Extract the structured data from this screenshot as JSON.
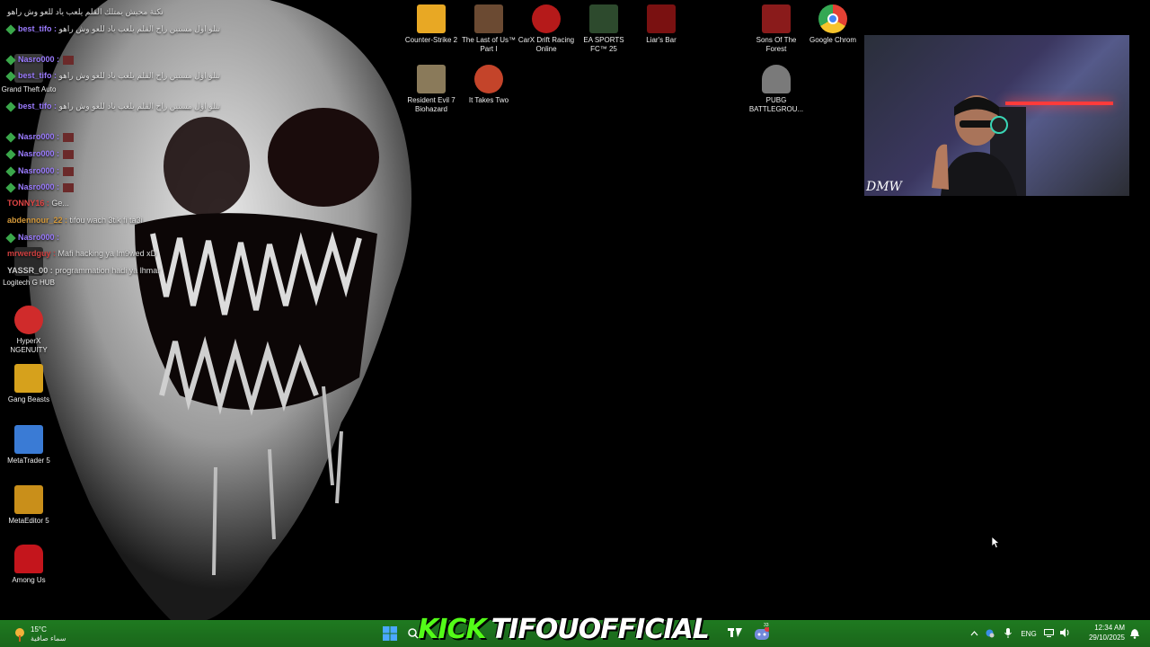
{
  "desktop": {
    "left_icons": [
      {
        "label": "Grand Theft Auto",
        "icon": "gta-icon",
        "color": "#3a3a3a"
      },
      {
        "label": "Logitech G HUB",
        "icon": "logitech-icon",
        "color": "#2a2a2a"
      },
      {
        "label": "HyperX NGENUITY",
        "icon": "hyperx-icon",
        "color": "#d02b2b"
      },
      {
        "label": "Gang Beasts",
        "icon": "gang-beasts-icon",
        "color": "#d6a11c"
      },
      {
        "label": "MetaTrader 5",
        "icon": "metatrader-icon",
        "color": "#3a7bd5"
      },
      {
        "label": "MetaEditor 5",
        "icon": "metaeditor-icon",
        "color": "#c98f1a"
      },
      {
        "label": "Among Us",
        "icon": "among-us-icon",
        "color": "#c4151c"
      }
    ],
    "top_icons": [
      {
        "label": "Counter-Strike 2",
        "icon": "cs2-icon",
        "color": "#e8a824"
      },
      {
        "label": "The Last of Us™ Part I",
        "icon": "tlou-icon",
        "color": "#6b4a32"
      },
      {
        "label": "CarX Drift Racing Online",
        "icon": "carx-icon",
        "color": "#b51a1a"
      },
      {
        "label": "EA SPORTS FC™ 25",
        "icon": "fc25-icon",
        "color": "#2d4a2d"
      },
      {
        "label": "Liar's Bar",
        "icon": "liars-bar-icon",
        "color": "#7a1111"
      },
      {
        "label": "Sons Of The Forest",
        "icon": "sotf-icon",
        "color": "#8a1b1b"
      },
      {
        "label": "Google Chrom",
        "icon": "chrome-icon",
        "color": "#e44134"
      },
      {
        "label": "Resident Evil 7 Biohazard",
        "icon": "re7-icon",
        "color": "#8a7a5a"
      },
      {
        "label": "It Takes Two",
        "icon": "it-takes-two-icon",
        "color": "#c4442a"
      },
      {
        "label": "PUBG BATTLEGROU...",
        "icon": "pubg-icon",
        "color": "#7a7a7a"
      }
    ]
  },
  "chat": [
    {
      "user": "",
      "msg": "نكتة محيش يمتلك القلم يلعب ياد للعو وش راهو"
    },
    {
      "user": "best_tifo :",
      "msg": "تبلو اول مستين راح القلم يلعب ياد للعو وش راهو"
    },
    {
      "user": "Nasro000 :",
      "msg": ""
    },
    {
      "user": "best_tifo :",
      "msg": "تبلو اول مستين راح القلم يلعب ياد للعو وش راهو"
    },
    {
      "user": "best_tifo :",
      "msg": "تبلو اول مستين راح القلم يلعب ياد للعو وش راهو"
    },
    {
      "user": "Nasro000 :",
      "msg": ""
    },
    {
      "user": "Nasro000 :",
      "msg": ""
    },
    {
      "user": "Nasro000 :",
      "msg": ""
    },
    {
      "user": "Nasro000 :",
      "msg": ""
    },
    {
      "user": "TONNY16 :",
      "msg": "Ge..."
    },
    {
      "user": "abdennour_22 :",
      "msg": "tifou wach 3tik fi ta3i"
    },
    {
      "user": "Nasro000 :",
      "msg": ""
    },
    {
      "user": "mrwerdguy :",
      "msg": "Mafi hacking ya lm9wed xD"
    },
    {
      "user": "YASSR_00 :",
      "msg": "programmation hadi ya lhmar"
    }
  ],
  "webcam": {
    "watermark": "DMW"
  },
  "taskbar": {
    "weather_temp": "15°C",
    "weather_desc": "سماء صافية",
    "kick_label": "KICK",
    "channel": "TIFOUOFFICIAL",
    "lang": "ENG",
    "time": "12:34 AM",
    "date": "29/10/2025",
    "discord_badge": "33"
  },
  "colors": {
    "taskbar": "#1d6b1d",
    "kick_green": "#53fc18"
  }
}
